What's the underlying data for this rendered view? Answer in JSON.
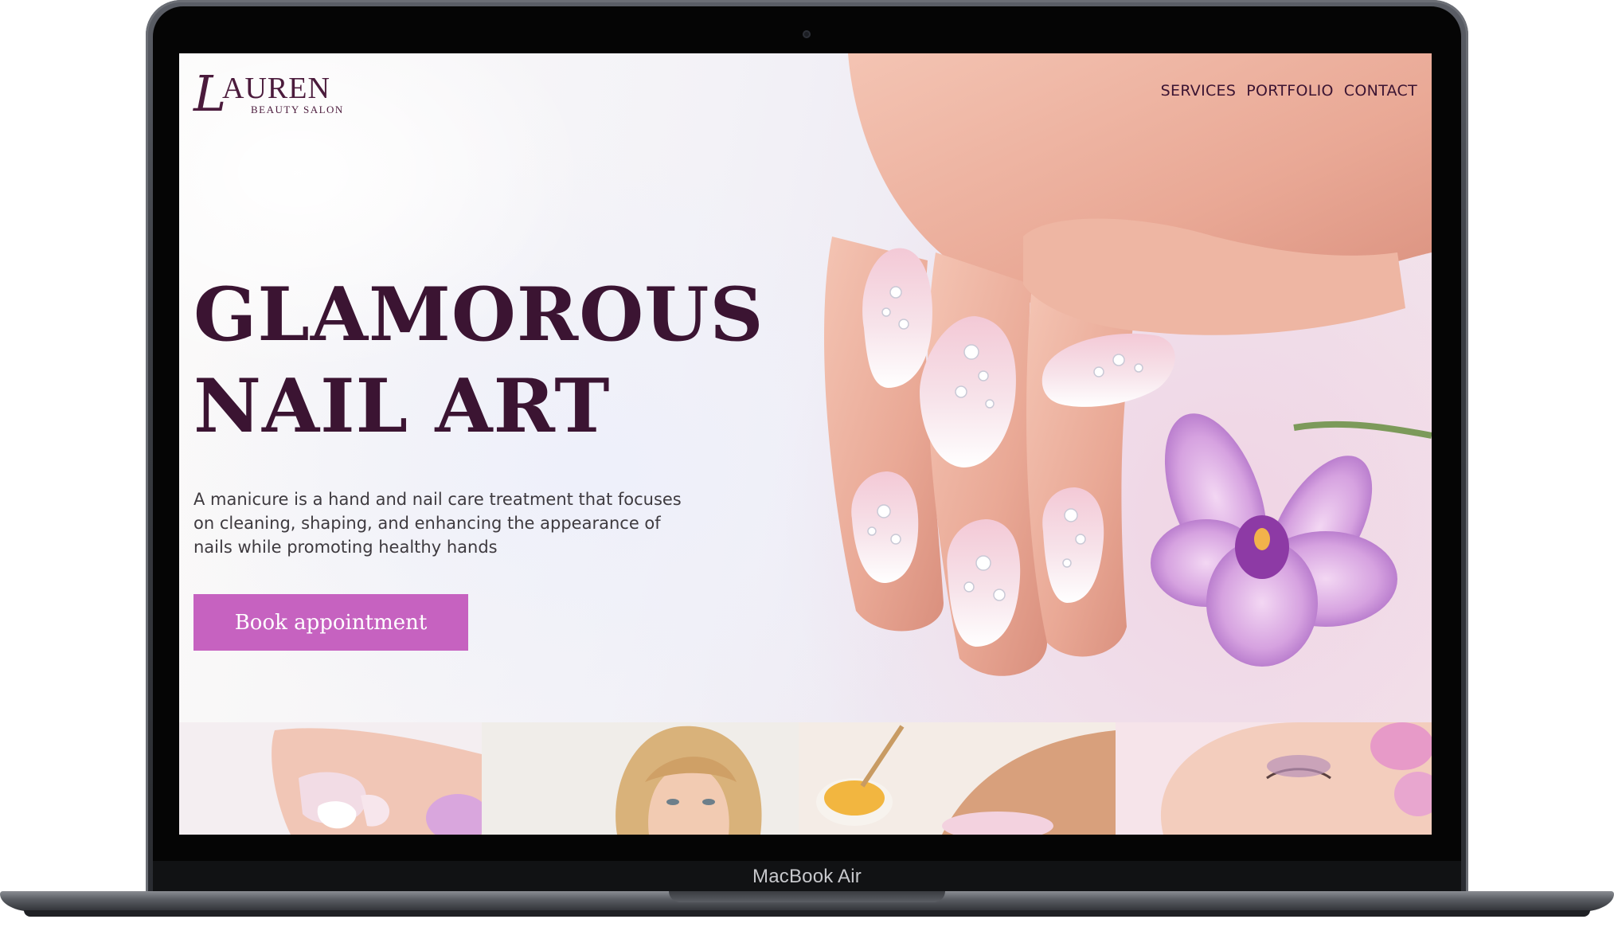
{
  "device": {
    "label": "MacBook Air"
  },
  "site": {
    "logo": {
      "initial": "L",
      "name": "AUREN",
      "tagline": "BEAUTY SALON"
    },
    "nav": [
      {
        "label": "SERVICES"
      },
      {
        "label": "PORTFOLIO"
      },
      {
        "label": "CONTACT"
      }
    ],
    "hero": {
      "title_line1": "GLAMOROUS",
      "title_line2": "NAIL ART",
      "description": "A manicure is a hand and nail care treatment that focuses on cleaning, shaping, and enhancing the appearance of nails while promoting healthy hands",
      "cta_label": "Book appointment"
    },
    "gallery": [
      {
        "icon": "manicure-photo"
      },
      {
        "icon": "hair-photo"
      },
      {
        "icon": "honey-spa-photo"
      },
      {
        "icon": "makeup-photo"
      }
    ]
  },
  "colors": {
    "brand_dark": "#3b1432",
    "accent": "#c662c0",
    "orchid": "#b36ad0"
  }
}
